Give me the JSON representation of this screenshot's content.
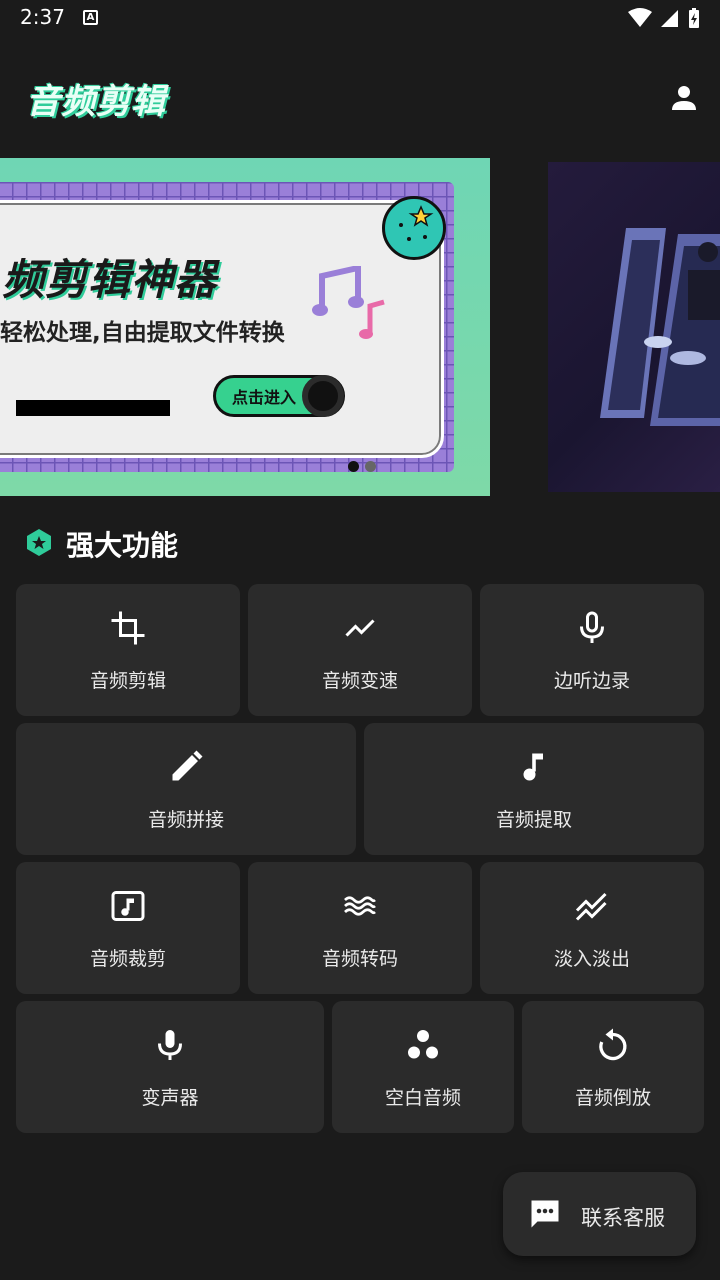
{
  "status_bar": {
    "time": "2:37",
    "notification_letter": "A"
  },
  "app_bar": {
    "title": "音频剪辑"
  },
  "banner": {
    "heading": "频剪辑神器",
    "subheading": "轻松处理,自由提取文件转换",
    "cta_label": "点击进入"
  },
  "section": {
    "title": "强大功能"
  },
  "features": [
    {
      "label": "音频剪辑",
      "icon": "crop-icon"
    },
    {
      "label": "音频变速",
      "icon": "trending-icon"
    },
    {
      "label": "边听边录",
      "icon": "mic-icon"
    },
    {
      "label": "音频拼接",
      "icon": "pencil-icon"
    },
    {
      "label": "音频提取",
      "icon": "music-note-icon"
    },
    {
      "label": "音频裁剪",
      "icon": "music-box-icon"
    },
    {
      "label": "音频转码",
      "icon": "waves-icon"
    },
    {
      "label": "淡入淡出",
      "icon": "fade-icon"
    },
    {
      "label": "变声器",
      "icon": "mic-icon"
    },
    {
      "label": "空白音频",
      "icon": "bubbles-icon"
    },
    {
      "label": "音频倒放",
      "icon": "replay-icon"
    }
  ],
  "contact": {
    "label": "联系客服"
  },
  "colors": {
    "background": "#1b1b1b",
    "tile": "#2b2b2b",
    "accent": "#2fcc9a"
  }
}
